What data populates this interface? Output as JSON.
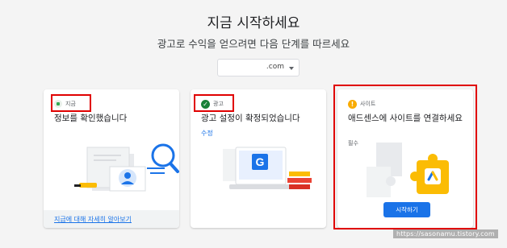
{
  "header": {
    "title": "지금 시작하세요",
    "subtitle": "광고로 수익을 얻으려면 다음 단계를 따르세요"
  },
  "site_select": {
    "value": ".com"
  },
  "cards": [
    {
      "status": "지금",
      "title": "정보를 확인했습니다",
      "footer_link": "지급에 대해 자세히 알아보기"
    },
    {
      "status": "광고",
      "title": "광고 설정이 확정되었습니다",
      "edit_link": "수정"
    },
    {
      "status": "사이트",
      "title": "애드센스에 사이트를 연결하세요",
      "required": "필수",
      "button": "시작하기"
    }
  ],
  "watermark": "https://sasonamu.tistory.com",
  "colors": {
    "accent": "#1a73e8",
    "success": "#188038",
    "warning": "#f9ab00",
    "highlight": "#e00000"
  }
}
